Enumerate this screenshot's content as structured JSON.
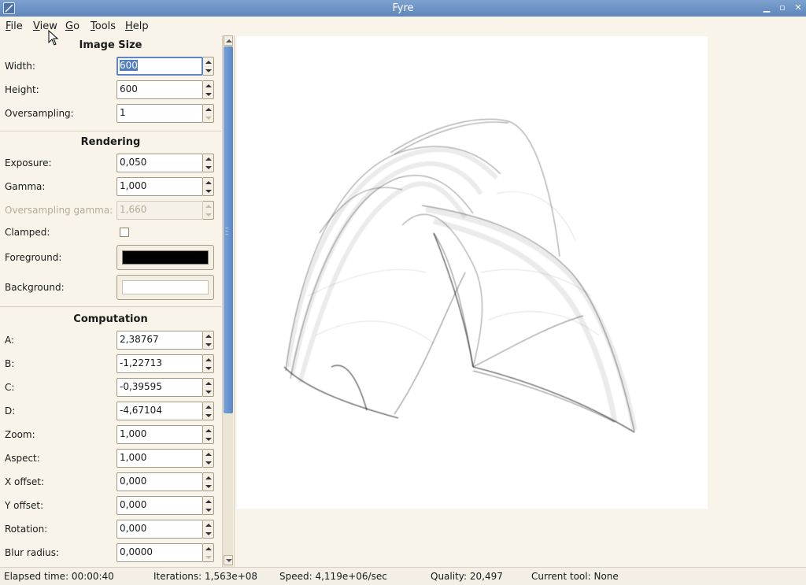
{
  "window": {
    "title": "Fyre"
  },
  "menu": [
    {
      "u": "F",
      "rest": "ile"
    },
    {
      "u": "V",
      "rest": "iew"
    },
    {
      "u": "G",
      "rest": "o"
    },
    {
      "u": "T",
      "rest": "ools"
    },
    {
      "u": "H",
      "rest": "elp"
    }
  ],
  "image_size": {
    "title": "Image Size",
    "width": {
      "label": "Width:",
      "value": "600"
    },
    "height": {
      "label": "Height:",
      "value": "600"
    },
    "oversampling": {
      "label": "Oversampling:",
      "value": "1"
    }
  },
  "rendering": {
    "title": "Rendering",
    "exposure": {
      "label": "Exposure:",
      "value": "0,050"
    },
    "gamma": {
      "label": "Gamma:",
      "value": "1,000"
    },
    "oversampling_gamma": {
      "label": "Oversampling gamma:",
      "value": "1,660"
    },
    "clamped": {
      "label": "Clamped:",
      "checked": false
    },
    "foreground": {
      "label": "Foreground:",
      "color": "#000000"
    },
    "background": {
      "label": "Background:",
      "color": "#ffffff"
    }
  },
  "computation": {
    "title": "Computation",
    "a": {
      "label": "A:",
      "value": "2,38767"
    },
    "b": {
      "label": "B:",
      "value": "-1,22713"
    },
    "c": {
      "label": "C:",
      "value": "-0,39595"
    },
    "d": {
      "label": "D:",
      "value": "-4,67104"
    },
    "zoom": {
      "label": "Zoom:",
      "value": "1,000"
    },
    "aspect": {
      "label": "Aspect:",
      "value": "1,000"
    },
    "x_offset": {
      "label": "X offset:",
      "value": "0,000"
    },
    "y_offset": {
      "label": "Y offset:",
      "value": "0,000"
    },
    "rotation": {
      "label": "Rotation:",
      "value": "0,000"
    },
    "blur_radius": {
      "label": "Blur radius:",
      "value": "0,0000"
    }
  },
  "status": {
    "elapsed": "Elapsed time: 00:00:40",
    "iterations": "Iterations: 1,563e+08",
    "speed": "Speed: 4,119e+06/sec",
    "quality": "Quality: 20,497",
    "tool": "Current tool: None"
  },
  "colors": {
    "accent": "#5e86bb",
    "selection": "#4f7dbe",
    "scrollbar": "#6a94cc"
  }
}
